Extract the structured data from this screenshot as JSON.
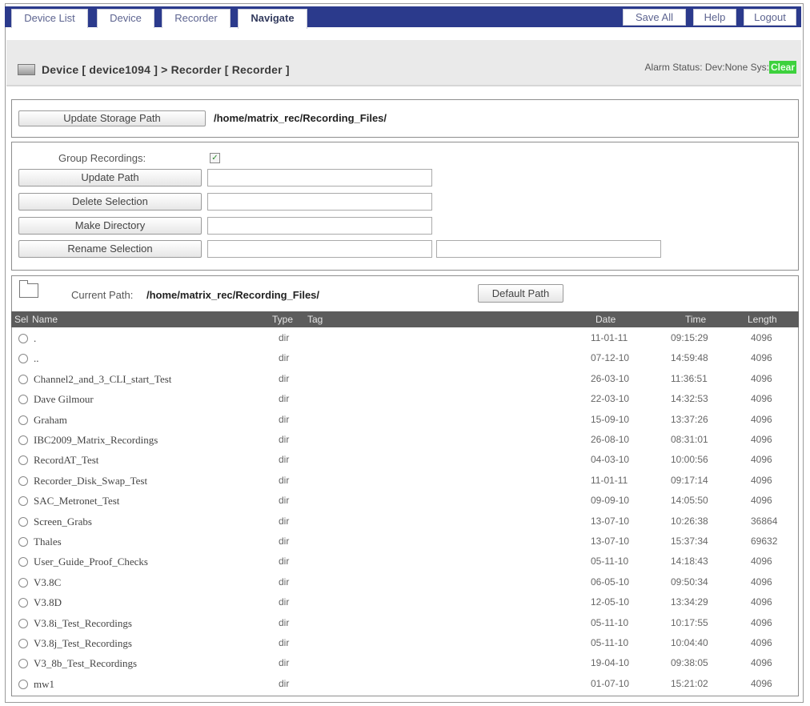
{
  "nav": {
    "tabs": [
      "Device List",
      "Device",
      "Recorder",
      "Navigate"
    ],
    "active_tab": "Navigate",
    "buttons": [
      "Save All",
      "Help",
      "Logout"
    ]
  },
  "header": {
    "breadcrumb": "Device [ device1094 ] > Recorder [ Recorder ]",
    "alarm_label": "Alarm Status:",
    "dev_status": "Dev:None",
    "sys_label": "Sys:",
    "sys_status": "Clear",
    "sys_status_color": "#3dd13d"
  },
  "storage": {
    "button_label": "Update Storage Path",
    "path": "/home/matrix_rec/Recording_Files/"
  },
  "actions": {
    "group_label": "Group Recordings:",
    "group_checked": true,
    "update_path_label": "Update Path",
    "delete_label": "Delete Selection",
    "make_dir_label": "Make Directory",
    "rename_label": "Rename Selection",
    "update_path_value": "",
    "delete_value": "",
    "make_dir_value": "",
    "rename_from_value": "",
    "rename_to_value": ""
  },
  "browser": {
    "current_path_label": "Current Path:",
    "current_path": "/home/matrix_rec/Recording_Files/",
    "default_path_label": "Default Path",
    "columns": {
      "sel": "Sel",
      "name": "Name",
      "type": "Type",
      "tag": "Tag",
      "date": "Date",
      "time": "Time",
      "length": "Length"
    },
    "rows": [
      {
        "name": ".",
        "type": "dir",
        "date": "11-01-11",
        "time": "09:15:29",
        "length": "4096"
      },
      {
        "name": "..",
        "type": "dir",
        "date": "07-12-10",
        "time": "14:59:48",
        "length": "4096"
      },
      {
        "name": "Channel2_and_3_CLI_start_Test",
        "type": "dir",
        "date": "26-03-10",
        "time": "11:36:51",
        "length": "4096"
      },
      {
        "name": "Dave Gilmour",
        "type": "dir",
        "date": "22-03-10",
        "time": "14:32:53",
        "length": "4096"
      },
      {
        "name": "Graham",
        "type": "dir",
        "date": "15-09-10",
        "time": "13:37:26",
        "length": "4096"
      },
      {
        "name": "IBC2009_Matrix_Recordings",
        "type": "dir",
        "date": "26-08-10",
        "time": "08:31:01",
        "length": "4096"
      },
      {
        "name": "RecordAT_Test",
        "type": "dir",
        "date": "04-03-10",
        "time": "10:00:56",
        "length": "4096"
      },
      {
        "name": "Recorder_Disk_Swap_Test",
        "type": "dir",
        "date": "11-01-11",
        "time": "09:17:14",
        "length": "4096"
      },
      {
        "name": "SAC_Metronet_Test",
        "type": "dir",
        "date": "09-09-10",
        "time": "14:05:50",
        "length": "4096"
      },
      {
        "name": "Screen_Grabs",
        "type": "dir",
        "date": "13-07-10",
        "time": "10:26:38",
        "length": "36864"
      },
      {
        "name": "Thales",
        "type": "dir",
        "date": "13-07-10",
        "time": "15:37:34",
        "length": "69632"
      },
      {
        "name": "User_Guide_Proof_Checks",
        "type": "dir",
        "date": "05-11-10",
        "time": "14:18:43",
        "length": "4096"
      },
      {
        "name": "V3.8C",
        "type": "dir",
        "date": "06-05-10",
        "time": "09:50:34",
        "length": "4096"
      },
      {
        "name": "V3.8D",
        "type": "dir",
        "date": "12-05-10",
        "time": "13:34:29",
        "length": "4096"
      },
      {
        "name": "V3.8i_Test_Recordings",
        "type": "dir",
        "date": "05-11-10",
        "time": "10:17:55",
        "length": "4096"
      },
      {
        "name": "V3.8j_Test_Recordings",
        "type": "dir",
        "date": "05-11-10",
        "time": "10:04:40",
        "length": "4096"
      },
      {
        "name": "V3_8b_Test_Recordings",
        "type": "dir",
        "date": "19-04-10",
        "time": "09:38:05",
        "length": "4096"
      },
      {
        "name": "mw1",
        "type": "dir",
        "date": "01-07-10",
        "time": "15:21:02",
        "length": "4096"
      }
    ]
  }
}
